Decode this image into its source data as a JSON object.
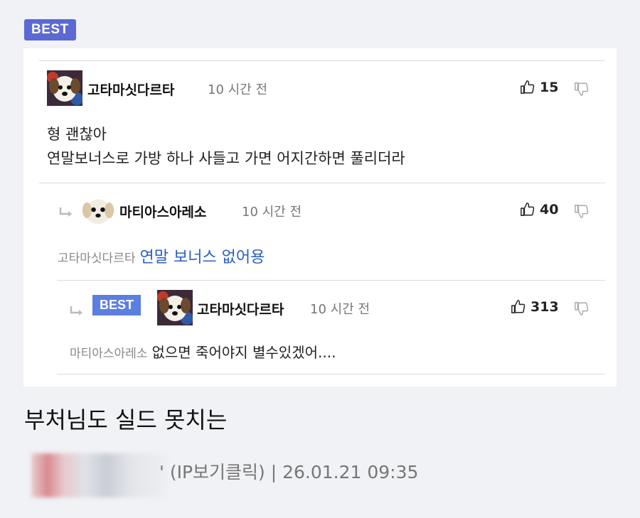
{
  "best_badge": "BEST",
  "comments": [
    {
      "nick": "고타마싯다르타",
      "time": "10 시간 전",
      "likes": "15",
      "lines": [
        "형 괜찮아",
        "연말보너스로 가방 하나 사들고 가면 어지간하면 풀리더라"
      ]
    },
    {
      "nick": "마티아스아레소",
      "time": "10 시간 전",
      "likes": "40",
      "mention": "고타마싯다르타",
      "text": "연말 보너스 없어용"
    },
    {
      "badge": "BEST",
      "nick": "고타마싯다르타",
      "time": "10 시간 전",
      "likes": "313",
      "mention": "마티아스아레소",
      "text": "없으면 죽어야지 별수있겠어...."
    }
  ],
  "post": {
    "title": "부처님도 실드 못치는",
    "meta": "' (IP보기클릭) | 26.01.21 09:35"
  },
  "icons": {
    "like": "thumbs-up-icon",
    "dislike": "thumbs-down-icon",
    "reply": "reply-arrow-icon"
  }
}
